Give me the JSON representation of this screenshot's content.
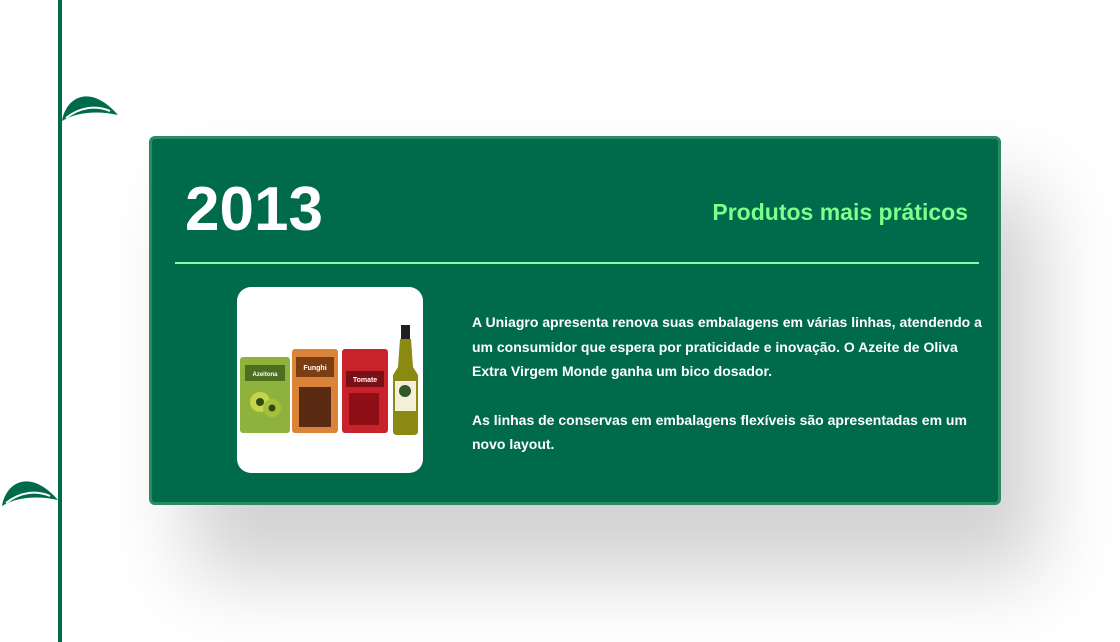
{
  "timeline": {
    "year": "2013",
    "title": "Produtos mais práticos",
    "paragraph_1": "A Uniagro apresenta renova suas embalagens em várias linhas, atendendo a um consumidor que espera por praticidade e inovação. O Azeite de Oliva Extra Virgem Monde ganha um bico dosador.",
    "paragraph_2": "As linhas de conservas em embalagens flexíveis são apresentadas em um novo layout."
  },
  "product_labels": {
    "pouch_1": "Azeitona",
    "pouch_2": "Funghi",
    "pouch_3": "Tomate"
  },
  "colors": {
    "primary_green": "#006b4a",
    "accent_green": "#7dff8e",
    "text_white": "#ffffff"
  },
  "icons": [
    "leaf-icon"
  ]
}
